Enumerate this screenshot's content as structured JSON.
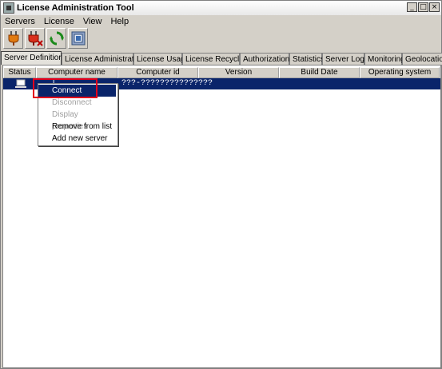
{
  "window": {
    "title": "License Administration Tool",
    "controls": [
      "_",
      "□",
      "×"
    ]
  },
  "menubar": {
    "items": [
      "Servers",
      "License",
      "View",
      "Help"
    ]
  },
  "toolbar": {
    "buttons": [
      "plug-connect-icon",
      "plug-disconnect-icon",
      "refresh-icon",
      "properties-icon"
    ]
  },
  "tabs": [
    "Server Definitions",
    "License Administration",
    "License Usage",
    "License Recycling",
    "Authorizations",
    "Statistics",
    "Server Logs",
    "Monitoring",
    "Geolocation"
  ],
  "table": {
    "columns": [
      "Status",
      "Computer name",
      "Computer id",
      "Version",
      "Build Date",
      "Operating system"
    ],
    "rows": [
      {
        "status_icon": "server-icon",
        "computer_name": "l",
        "computer_id": "???-???????????????",
        "version": "",
        "build_date": "",
        "os": ""
      }
    ]
  },
  "context_menu": {
    "items": [
      {
        "label": "Connect",
        "enabled": true,
        "highlighted": true
      },
      {
        "label": "Disconnect",
        "enabled": false
      },
      {
        "label": "Display properties",
        "enabled": false
      },
      {
        "label": "Remove from list",
        "enabled": true
      },
      {
        "label": "Add new server",
        "enabled": true
      }
    ]
  },
  "colors": {
    "selection": "#0a246a",
    "annotation": "#e3001b",
    "chrome": "#d4d0c8"
  }
}
